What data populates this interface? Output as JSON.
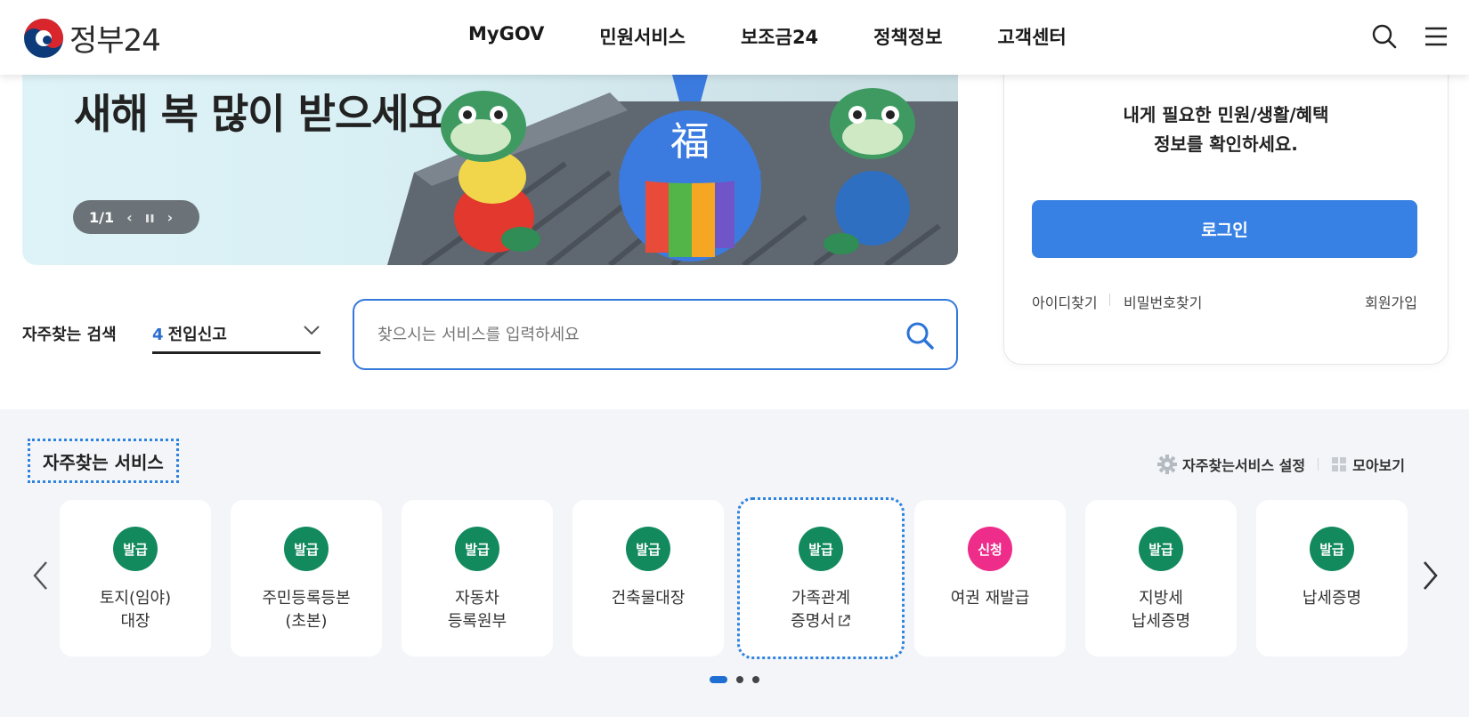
{
  "header": {
    "logo_text": "정부24",
    "nav": [
      "MyGOV",
      "민원서비스",
      "보조금24",
      "정책정보",
      "고객센터"
    ]
  },
  "banner": {
    "title": "새해 복 많이 받으세요.",
    "page_indicator": "1/1",
    "prev": "‹",
    "pause": "ıı",
    "next": "›",
    "art_character": "福"
  },
  "login": {
    "message_line1": "내게 필요한 민원/생활/혜택",
    "message_line2": "정보를 확인하세요.",
    "button": "로그인",
    "find_id": "아이디찾기",
    "find_password": "비밀번호찾기",
    "signup": "회원가입"
  },
  "search": {
    "favorites_label": "자주찾는 검색",
    "selected_number": "4",
    "selected_text": "전입신고",
    "placeholder": "찾으시는 서비스를 입력하세요"
  },
  "services": {
    "title": "자주찾는 서비스",
    "settings": "자주찾는서비스 설정",
    "view_all": "모아보기",
    "items": [
      {
        "badge": "발급",
        "line1": "토지(임야)",
        "line2": "대장"
      },
      {
        "badge": "발급",
        "line1": "주민등록등본",
        "line2": "(초본)"
      },
      {
        "badge": "발급",
        "line1": "자동차",
        "line2": "등록원부"
      },
      {
        "badge": "발급",
        "line1": "건축물대장",
        "line2": ""
      },
      {
        "badge": "발급",
        "line1": "가족관계",
        "line2": "증명서"
      },
      {
        "badge": "신청",
        "line1": "여권 재발급",
        "line2": ""
      },
      {
        "badge": "발급",
        "line1": "지방세",
        "line2": "납세증명"
      },
      {
        "badge": "발급",
        "line1": "납세증명",
        "line2": ""
      }
    ],
    "pages": 3,
    "active_page": 1
  },
  "colors": {
    "primary_blue": "#3780e4",
    "issue_badge": "#138a5e",
    "apply_badge": "#ee2c8a",
    "focus_outline": "#2f83de"
  }
}
